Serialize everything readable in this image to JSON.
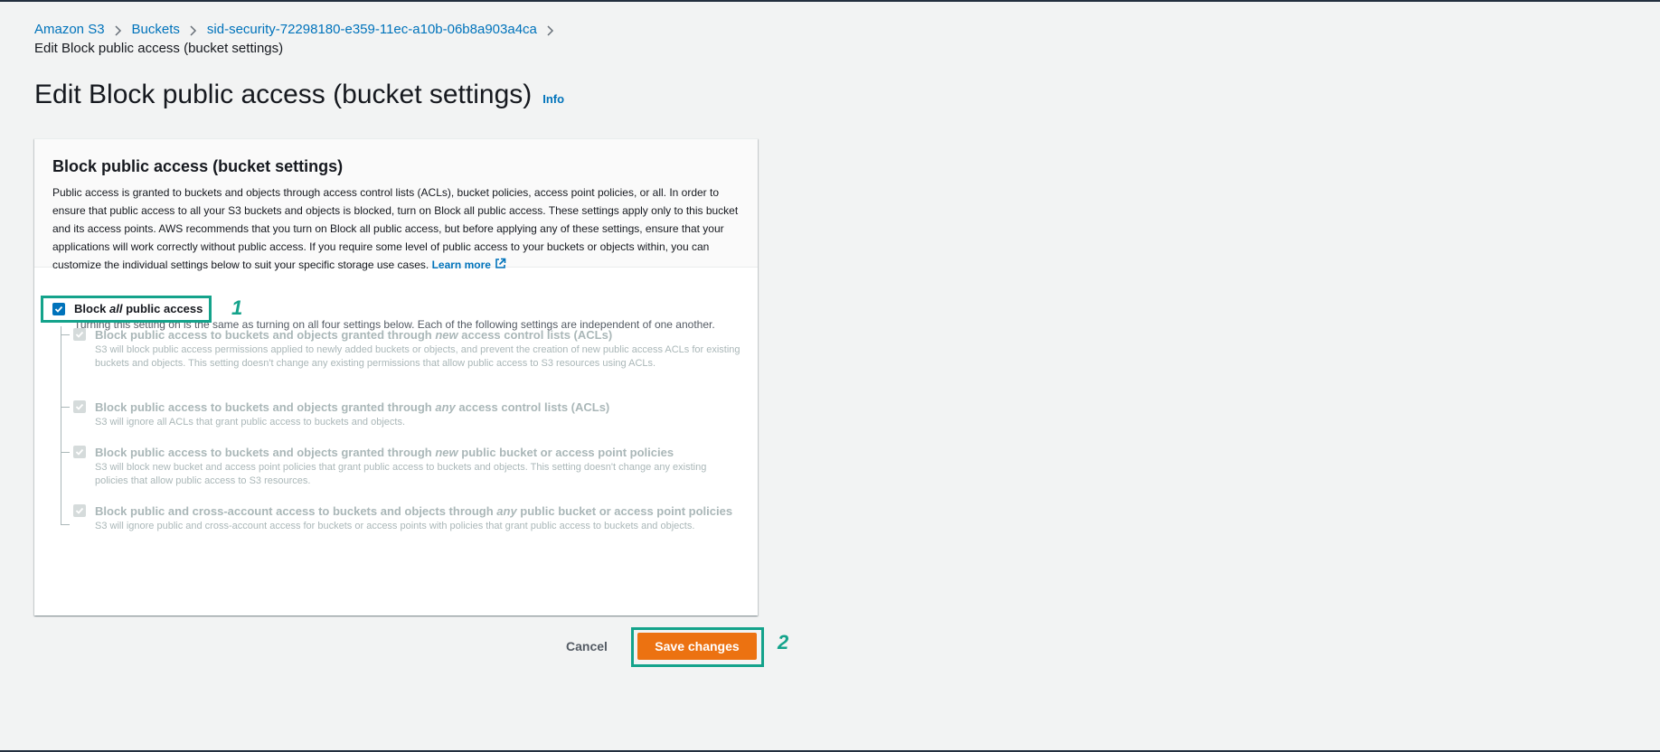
{
  "breadcrumb": {
    "items": [
      "Amazon S3",
      "Buckets",
      "sid-security-72298180-e359-11ec-a10b-06b8a903a4ca"
    ],
    "current": "Edit Block public access (bucket settings)"
  },
  "page": {
    "title": "Edit Block public access (bucket settings)",
    "info_label": "Info"
  },
  "panel": {
    "title": "Block public access (bucket settings)",
    "description": "Public access is granted to buckets and objects through access control lists (ACLs), bucket policies, access point policies, or all. In order to ensure that public access to all your S3 buckets and objects is blocked, turn on Block all public access. These settings apply only to this bucket and its access points. AWS recommends that you turn on Block all public access, but before applying any of these settings, ensure that your applications will work correctly without public access. If you require some level of public access to your buckets or objects within, you can customize the individual settings below to suit your specific storage use cases.",
    "learn_more": "Learn more"
  },
  "block_all": {
    "label_pre": "Block ",
    "label_em": "all",
    "label_post": " public access",
    "checked": true,
    "description": "Turning this setting on is the same as turning on all four settings below. Each of the following settings are independent of one another."
  },
  "options": [
    {
      "title_pre": "Block public access to buckets and objects granted through ",
      "title_em": "new",
      "title_post": " access control lists (ACLs)",
      "description": "S3 will block public access permissions applied to newly added buckets or objects, and prevent the creation of new public access ACLs for existing buckets and objects. This setting doesn't change any existing permissions that allow public access to S3 resources using ACLs.",
      "checked": true
    },
    {
      "title_pre": "Block public access to buckets and objects granted through ",
      "title_em": "any",
      "title_post": " access control lists (ACLs)",
      "description": "S3 will ignore all ACLs that grant public access to buckets and objects.",
      "checked": true
    },
    {
      "title_pre": "Block public access to buckets and objects granted through ",
      "title_em": "new",
      "title_post": " public bucket or access point policies",
      "description": "S3 will block new bucket and access point policies that grant public access to buckets and objects. This setting doesn't change any existing policies that allow public access to S3 resources.",
      "checked": true
    },
    {
      "title_pre": "Block public and cross-account access to buckets and objects through ",
      "title_em": "any",
      "title_post": " public bucket or access point policies",
      "description": "S3 will ignore public and cross-account access for buckets or access points with policies that grant public access to buckets and objects.",
      "checked": true
    }
  ],
  "actions": {
    "cancel_label": "Cancel",
    "save_label": "Save changes"
  },
  "annotations": {
    "marker_1": "1",
    "marker_2": "2"
  },
  "colors": {
    "link": "#0073bb",
    "primary_button": "#ec7211",
    "highlight": "#14a38b",
    "disabled_text": "#aab7b8"
  },
  "icons": {
    "breadcrumb_separator": "chevron-right-icon",
    "external_link": "external-link-icon",
    "checkbox": "checkmark-icon"
  }
}
